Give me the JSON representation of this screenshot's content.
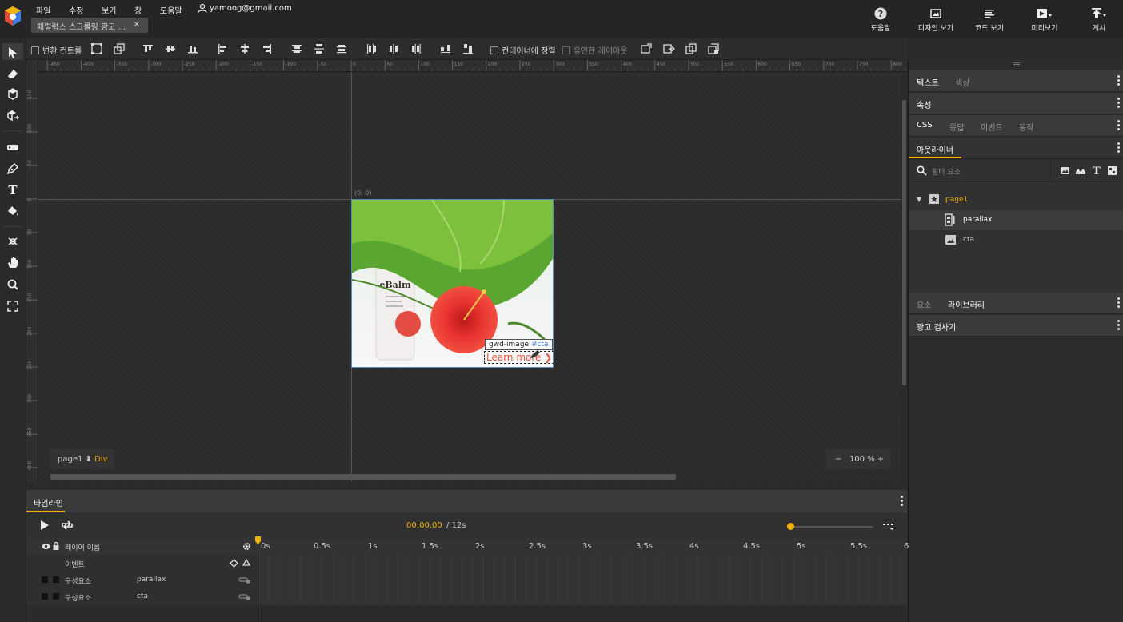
{
  "menu": {
    "items": [
      "파일",
      "수정",
      "보기",
      "창",
      "도움말"
    ],
    "user": "yamoog@gmail.com"
  },
  "doc_tab": {
    "title": "패럴럭스 스크롤링 광고 ...",
    "close": "×"
  },
  "top_buttons": {
    "help": "도움말",
    "design_view": "디자인 보기",
    "code_view": "코드 보기",
    "preview": "미리보기",
    "publish": "게시"
  },
  "toolbar": {
    "transform_control": "변환 컨트롤",
    "align_container": "컨테이너에 정렬",
    "fluid_layout": "유연한 레이아웃"
  },
  "ruler_top": [
    "-450",
    "-400",
    "-350",
    "-300",
    "-250",
    "-200",
    "-150",
    "-100",
    "-50",
    "0",
    "50",
    "100",
    "150",
    "200",
    "250",
    "300",
    "350",
    "400",
    "450",
    "500",
    "550",
    "600",
    "650",
    "700",
    "750",
    "800"
  ],
  "ruler_left": [
    "-150",
    "-100",
    "-50",
    "0",
    "50",
    "100",
    "150",
    "200",
    "250",
    "300",
    "350",
    "400"
  ],
  "canvas": {
    "origin_label": "(0, 0)",
    "badge_type": "gwd-image",
    "badge_id": "#cta",
    "cta_text": "Learn more"
  },
  "page_indicator": {
    "page": "page1",
    "arrows": "⬍",
    "element": "Div"
  },
  "zoom": {
    "minus": "−",
    "value": "100 %",
    "plus": "+"
  },
  "right_panel": {
    "text_tab": "텍스트",
    "color_tab": "색상",
    "properties": "속성",
    "css_tab": "CSS",
    "responsive_tab": "응답",
    "events_tab": "이벤트",
    "animation_tab": "동작",
    "outliner_tab": "아웃라이너",
    "filter_placeholder": "필터 요소",
    "tree": {
      "page": "page1",
      "items": [
        "parallax",
        "cta"
      ]
    },
    "elements_tab": "요소",
    "library_tab": "라이브러리",
    "ad_inspector": "광고 검사기"
  },
  "timeline": {
    "title": "타임라인",
    "time": "00:00.00",
    "duration": "/ 12s",
    "layer_header": "레이어 이름",
    "events_label": "이벤트",
    "ticks": [
      "0s",
      "0.5s",
      "1s",
      "1.5s",
      "2s",
      "2.5s",
      "3s",
      "3.5s",
      "4s",
      "4.5s",
      "5s",
      "5.5s",
      "6"
    ],
    "rows": [
      {
        "type": "구성요소",
        "name": "parallax"
      },
      {
        "type": "구성요소",
        "name": "cta"
      }
    ]
  },
  "colors": {
    "accent": "#f0b400",
    "selection": "#4a90c0",
    "cta": "#f0533c"
  }
}
